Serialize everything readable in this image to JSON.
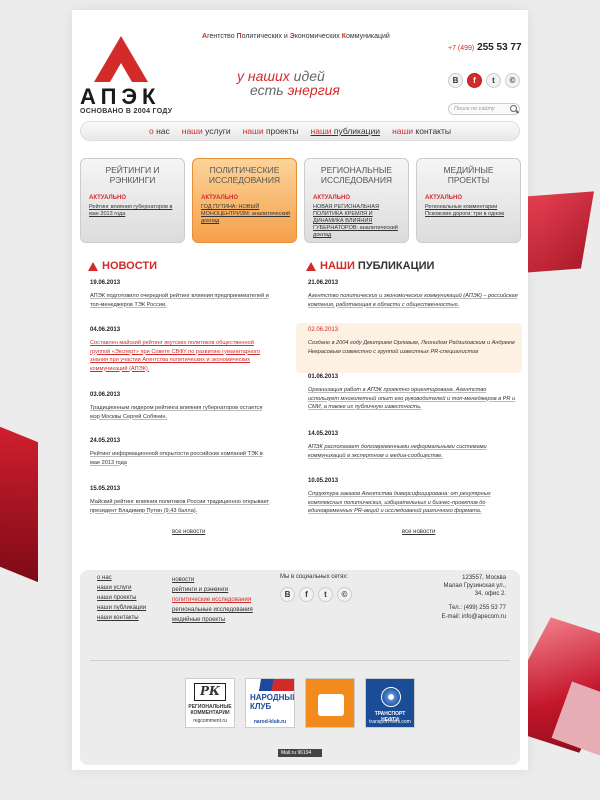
{
  "header": {
    "logo_text": "АПЭК",
    "logo_since": "ОСНОВАНО В 2004 ГОДУ",
    "agency_parts": [
      {
        "letter": "А",
        "rest": "гентство "
      },
      {
        "letter": "П",
        "rest": "олитических и "
      },
      {
        "letter": "Э",
        "rest": "кономических "
      },
      {
        "letter": "К",
        "rest": "оммуникаций"
      }
    ],
    "phone_code": "+7 (499)",
    "phone_number": "255 53 77",
    "slogan_line1_red": "у наших",
    "slogan_line1_grey": " идей",
    "slogan_line2_grey": "есть ",
    "slogan_line2_red": "энергия",
    "social": [
      "В",
      "f",
      "t",
      "©"
    ],
    "search_placeholder": "Поиск по сайту"
  },
  "nav": [
    {
      "r": "о",
      "rest": " нас"
    },
    {
      "r": "наши",
      "rest": " услуги"
    },
    {
      "r": "наши",
      "rest": " проекты"
    },
    {
      "r": "наши",
      "rest": " публикации"
    },
    {
      "r": "наши",
      "rest": " контакты"
    }
  ],
  "tabs": [
    {
      "title": "Рейтинги и рэнкинги",
      "label": "АКТУАЛЬНО",
      "text": "Рейтинг влияния губернаторов в мае 2013 года"
    },
    {
      "title": "Политические исследования",
      "label": "АКТУАЛЬНО",
      "text": "ГОД ПУТИНА: НОВЫЙ МОНОЦЕНТРИЗМ: аналитический доклад"
    },
    {
      "title": "Региональные исследования",
      "label": "АКТУАЛЬНО",
      "text": "НОВАЯ РЕГИОНАЛЬНАЯ ПОЛИТИКА КРЕМЛЯ И ДИНАМИКА ВЛИЯНИЯ ГУБЕРНАТОРОВ: аналитический доклад"
    },
    {
      "title": "Медийные проекты",
      "label": "АКТУАЛЬНО",
      "text": "Региональные комментарии Псковские дороги: три в одном"
    }
  ],
  "news": {
    "title_red": "НОВОСТИ",
    "items": [
      {
        "date": "19.06.2013",
        "text": "АПЭК подготовило очередной рейтинг влияния предпринимателей и топ-менеджеров ТЭК России."
      },
      {
        "date": "04.06.2013",
        "text": "Составлен майский рейтинг якутских политиков общественной группой «Эксперт» при Совете СВФУ по развитию гуманитарного знания при участии Агентства политических и экономических коммуникаций (АПЭК)."
      },
      {
        "date": "03.06.2013",
        "text": "Традиционным лидером рейтинга влияния губернаторов остается мэр Москвы Сергей Собянин."
      },
      {
        "date": "24.05.2013",
        "text": "Рейтинг информационной открытости российских компаний ТЭК в мае 2013 года"
      },
      {
        "date": "15.05.2013",
        "text": "Майский рейтинг влияния политиков России традиционно открывает президент Владимир Путин (9,43 балла)."
      }
    ],
    "all_link": "все новости"
  },
  "pubs": {
    "title_red": "НАШИ",
    "title_dark": " ПУБЛИКАЦИИ",
    "items": [
      {
        "date": "21.06.2013",
        "text": "Агентство политических и экономических коммуникаций (АПЭК) – российская компания, работающая в области с общественностью."
      },
      {
        "date": "02.06.2013",
        "text": "Создано в 2004 году Дмитрием Орловым, Леонидом Радзиховским и Андреем Некрасовым совместно с группой известных PR-специалистов"
      },
      {
        "date": "01.06.2013",
        "text": "Организация работ в АПЭК проектно ориентирована. Агентство использует многолетний опыт его руководителей и топ-менеджеров в PR и СМИ, а также их публичную известность."
      },
      {
        "date": "14.05.2013",
        "text": "АПЭК располагает долговременными неформальными системами коммуникаций в экспертном и медиа-сообществе."
      },
      {
        "date": "10.05.2013",
        "text": "Структура заказов Агентства диверсифицирована: от регулярных комплексных политических, избирательных и бизнес-проектов до единовременных PR-акций и исследований различного формата."
      }
    ],
    "all_link": "все новости"
  },
  "footer": {
    "col1": [
      "о нас",
      "наши услуги",
      "наши проекты",
      "наши публикации",
      "наши контакты"
    ],
    "col2": [
      "новости",
      "рейтинги и рэнкинги",
      "политические исследования",
      "региональные исследования",
      "медийные проекты"
    ],
    "social_title": "Мы в социальных сетях:",
    "social": [
      "В",
      "f",
      "t",
      "©"
    ],
    "address": [
      "123557, Москва",
      "Малая Грузинская ул.,",
      "34, офис 2."
    ],
    "tel": "Тел.: (499) 255 53 77",
    "email": "E-mail: info@apecom.ru",
    "partners": {
      "rk_logo": "РК",
      "rk_caption": "РЕГИОНАЛЬНЫЕ КОММЕНТАРИИ",
      "rk_url": "regcomment.ru",
      "club_text": "НАРОДНЫЙ КЛУБ",
      "club_url": "narod-klub.ru",
      "oil_caption": "ТРАНСПОРТ НЕФТИ",
      "oil_url": "transport-nefti.com"
    },
    "counter": "Mail.ru 96194"
  },
  "colors": {
    "accent": "#d32a2a",
    "tab_active": "#f5a04a"
  }
}
